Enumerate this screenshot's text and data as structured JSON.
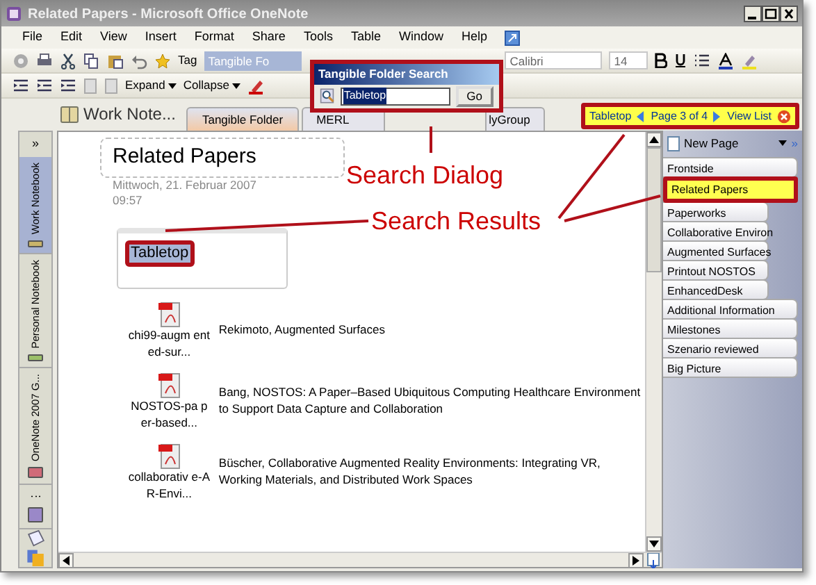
{
  "window": {
    "title": "Related Papers - Microsoft Office OneNote"
  },
  "menu": [
    "File",
    "Edit",
    "View",
    "Insert",
    "Format",
    "Share",
    "Tools",
    "Table",
    "Window",
    "Help"
  ],
  "toolbar_1": {
    "tag_label": "Tag",
    "search_field": "Tangible Fo",
    "font": "Calibri",
    "font_size": "14"
  },
  "toolbar_2": {
    "expand": "Expand",
    "collapse": "Collapse"
  },
  "notebook_title": "Work Note...",
  "section_tabs": [
    {
      "label": "Tangible Folder",
      "selected": true
    },
    {
      "label": "MERL",
      "selected": false
    },
    {
      "label": "lyGroup",
      "selected": false
    }
  ],
  "search_bar": {
    "query": "Tabletop",
    "page_info": "Page 3 of 4",
    "view_list": "View List"
  },
  "sidebar": {
    "expand": "»",
    "notebooks": [
      {
        "label": "Work Notebook",
        "selected": true,
        "color": "#c9b46a"
      },
      {
        "label": "Personal Notebook",
        "selected": false,
        "color": "#9cc06a"
      },
      {
        "label": "OneNote 2007 G...",
        "selected": false,
        "color": "#d06a78"
      },
      {
        "label": "⋮",
        "selected": false,
        "color": "#9a88c8"
      }
    ]
  },
  "page": {
    "title": "Related Papers",
    "date": "Mittwoch, 21. Februar 2007",
    "time": "09:57",
    "note": "Tabletop",
    "attachments": [
      {
        "file": "chi99-augm ented-sur...",
        "description": "Rekimoto, Augmented Surfaces"
      },
      {
        "file": "NOSTOS-pa per-based...",
        "description": "Bang, NOSTOS: A Paper–Based Ubiquitous Computing Healthcare Environment to Support Data Capture and Collaboration"
      },
      {
        "file": "collaborativ e-AR-Envi...",
        "description": "Büscher, Collaborative Augmented Reality Environments: Integrating VR, Working Materials, and Distributed Work Spaces"
      }
    ]
  },
  "new_page": "New Page",
  "page_tabs": [
    {
      "label": "Frontside",
      "kind": "page",
      "selected": false
    },
    {
      "label": "Related Papers",
      "kind": "page",
      "selected": true
    },
    {
      "label": "Paperworks",
      "kind": "subpage",
      "selected": false
    },
    {
      "label": "Collaborative Environ",
      "kind": "subpage",
      "selected": false
    },
    {
      "label": "Augmented Surfaces",
      "kind": "subpage",
      "selected": false
    },
    {
      "label": "Printout NOSTOS",
      "kind": "subpage",
      "selected": false
    },
    {
      "label": "EnhancedDesk",
      "kind": "subpage",
      "selected": false
    },
    {
      "label": "Additional Information",
      "kind": "page",
      "selected": false
    },
    {
      "label": "Milestones",
      "kind": "page",
      "selected": false
    },
    {
      "label": "Szenario reviewed",
      "kind": "page",
      "selected": false
    },
    {
      "label": "Big Picture",
      "kind": "page",
      "selected": false
    }
  ],
  "dialog": {
    "title": "Tangible Folder Search",
    "value": "Tabletop",
    "button": "Go"
  },
  "annotations": [
    {
      "text": "Search Dialog"
    },
    {
      "text": "Search Results"
    }
  ]
}
